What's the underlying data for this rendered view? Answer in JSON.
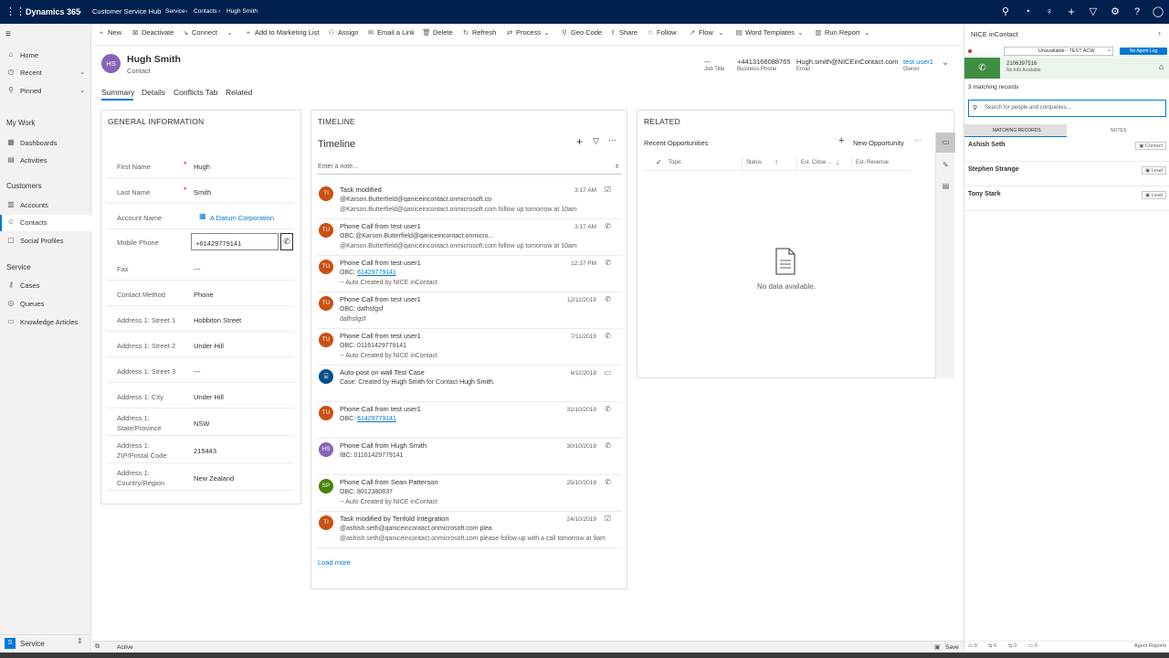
{
  "topbar": {
    "app_name": "Dynamics 365",
    "app_module": "Customer Service Hub",
    "breadcrumb": [
      "Service",
      "Contacts",
      "Hugh Smith"
    ],
    "icons": [
      "search-icon",
      "assistant-icon",
      "lightbulb-icon",
      "plus-icon",
      "filter-icon",
      "settings-icon",
      "help-icon",
      "user-icon"
    ]
  },
  "nav": {
    "home": "Home",
    "recent": "Recent",
    "pinned": "Pinned",
    "my_work": "My Work",
    "dashboards": "Dashboards",
    "activities": "Activities",
    "customers": "Customers",
    "accounts": "Accounts",
    "contacts": "Contacts",
    "social_profiles": "Social Profiles",
    "service": "Service",
    "cases": "Cases",
    "queues": "Queues",
    "knowledge_articles": "Knowledge Articles",
    "area_badge": "S",
    "area_label": "Service"
  },
  "commands": {
    "new": "New",
    "deactivate": "Deactivate",
    "connect": "Connect",
    "add_marketing": "Add to Marketing List",
    "assign": "Assign",
    "email_link": "Email a Link",
    "delete": "Delete",
    "refresh": "Refresh",
    "process": "Process",
    "geo_code": "Geo Code",
    "share": "Share",
    "follow": "Follow",
    "flow": "Flow",
    "word_templates": "Word Templates",
    "run_report": "Run Report"
  },
  "record": {
    "initials": "HS",
    "name": "Hugh Smith",
    "entity": "Contact",
    "job_title_value": "---",
    "job_title_label": "Job Title",
    "phone_value": "+4413166088765",
    "phone_label": "Business Phone",
    "email_value": "Hugh.smith@NICEinContact.com",
    "email_label": "Email",
    "owner_value": "test user1",
    "owner_label": "Owner"
  },
  "tabs": [
    "Summary",
    "Details",
    "Conflicts Tab",
    "Related"
  ],
  "general": {
    "title": "GENERAL INFORMATION",
    "fields": [
      {
        "label": "First Name",
        "value": "Hugh"
      },
      {
        "label": "Last Name",
        "value": "Smith"
      },
      {
        "label": "Account Name",
        "value": "A Datum Corporation"
      },
      {
        "label": "Mobile Phone",
        "value": "+61429779141"
      },
      {
        "label": "Fax",
        "value": "---"
      },
      {
        "label": "Contact Method",
        "value": "Phone"
      },
      {
        "label": "Address 1: Street 1",
        "value": "Hobbiton Street"
      },
      {
        "label": "Address 1: Street 2",
        "value": "Under Hill"
      },
      {
        "label": "Address 1: Street 3",
        "value": "---"
      },
      {
        "label": "Address 1: City",
        "value": "Under Hill"
      },
      {
        "label": "Address 1: State/Province",
        "value": "NSW"
      },
      {
        "label": "Address 1: ZIP/Postal Code",
        "value": "215443"
      },
      {
        "label": "Address 1: Country/Region",
        "value": "New Zealand"
      }
    ]
  },
  "timeline": {
    "section": "TIMELINE",
    "title": "Timeline",
    "note_placeholder": "Enter a note...",
    "load_more": "Load more",
    "items": [
      {
        "initials": "TI",
        "color": "#ca5010",
        "title": "Task modified",
        "line2": "@Karson.Butterfield@qaniceincontact.onmicrosoft.co",
        "line3": "@Karson.Butterfield@qaniceincontact.onmicrosoft.com follow up tomorrow at 10am",
        "date": "3:17 AM",
        "icon": "task-icon"
      },
      {
        "initials": "TU",
        "color": "#ca5010",
        "title": "Phone Call from test user1",
        "line2": "OBC:@Karson.Butterfield@qaniceincontact.onmicro...",
        "line3": "@Karson.Butterfield@qaniceincontact.onmicrosoft.com follow up tomorrow at 10am",
        "date": "3:17 AM",
        "icon": "phone-icon"
      },
      {
        "initials": "TU",
        "color": "#ca5010",
        "title": "Phone Call from test user1",
        "line2_prefix": "OBC: ",
        "line2_link": "61429779141",
        "line3": "-- Auto Created by NICE inContact",
        "date": "12:37 PM",
        "icon": "phone-icon"
      },
      {
        "initials": "TU",
        "color": "#ca5010",
        "title": "Phone Call from test user1",
        "line2": "OBC: dafhsfgsf",
        "line3": "dafhsfgsf",
        "date": "12/11/2019",
        "icon": "phone-icon"
      },
      {
        "initials": "TU",
        "color": "#ca5010",
        "title": "Phone Call from test user1",
        "line2": "OBC: 01161429779141",
        "line3": "-- Auto Created by NICE inContact",
        "date": "7/11/2019",
        "icon": "phone-icon"
      },
      {
        "initials": "",
        "color": "#004e8c",
        "title": "Auto-post on wall Test Case",
        "line2_a": "Case: Created by ",
        "line2_b": "Hugh Smith",
        "line2_c": " for Contact ",
        "line2_d": "Hugh Smith",
        "line2_e": ".",
        "date": "6/11/2019",
        "icon": "post-icon"
      },
      {
        "initials": "TU",
        "color": "#ca5010",
        "title": "Phone Call from test user1",
        "line2_prefix": "OBC: ",
        "line2_link": "61429779141",
        "date": "31/10/2019",
        "icon": "phone-icon"
      },
      {
        "initials": "HS",
        "color": "#8764b8",
        "title": "Phone Call from Hugh Smith",
        "line2": "IBC: 01161429779141",
        "date": "30/10/2019",
        "icon": "phone-icon"
      },
      {
        "initials": "SP",
        "color": "#498205",
        "title": "Phone Call from Sean Patterson",
        "line2": "OBC: 8012380837",
        "line3": "-- Auto Created by NICE inContact",
        "date": "25/10/2019",
        "icon": "phone-icon"
      },
      {
        "initials": "TI",
        "color": "#ca5010",
        "title": "Task modified by Tenfold Integration",
        "line2": "@ashish.seth@qaniceincontact.onmicrosoft.com  plea",
        "line3": "@ashish.seth@qaniceincontact.onmicrosoft.com  please follow up with a call tomorrow at 9am",
        "date": "24/10/2019",
        "icon": "task-icon"
      }
    ]
  },
  "related": {
    "section": "RELATED",
    "title": "Recent Opportunities",
    "new_label": "New Opportunity",
    "columns": [
      "Topic",
      "Status",
      "Est. Close ...",
      "Est. Revenue"
    ],
    "empty": "No data available."
  },
  "status_bar": {
    "status": "Active",
    "save": "Save"
  },
  "nice": {
    "title": "NICE inContact",
    "state": "Unavailable - TEST ACW",
    "agent_leg": "No Agent Leg",
    "phone": "2106397516",
    "phone_sub": "No Info Available",
    "matching": "3 matching records",
    "search_placeholder": "Search for people and companies...",
    "tab_records": "MATCHING RECORDS",
    "tab_notes": "NOTES",
    "records": [
      {
        "name": "Ashish Seth",
        "type": "Contact"
      },
      {
        "name": "Stephen Strange",
        "type": "Lead"
      },
      {
        "name": "Tony Stark",
        "type": "Lead"
      }
    ],
    "footer_counts": [
      "0",
      "0",
      "0",
      "0"
    ],
    "agent_reports": "Agent Reports"
  }
}
